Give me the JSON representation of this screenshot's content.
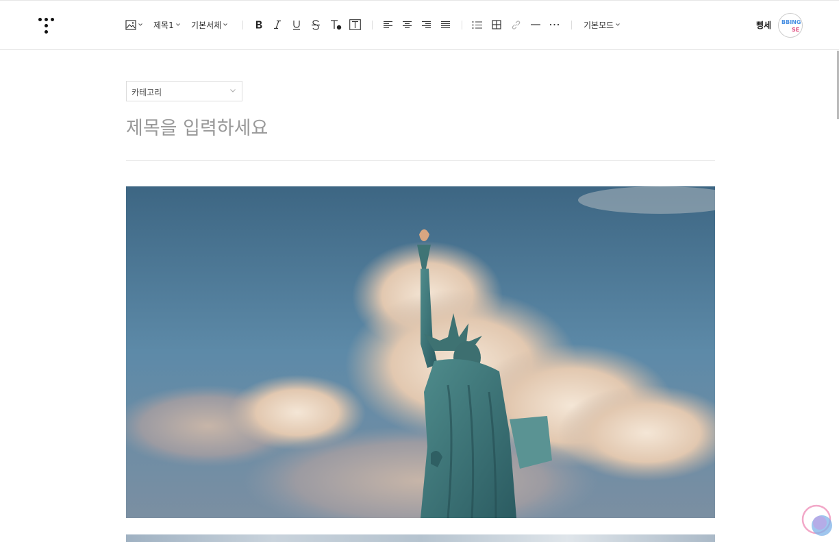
{
  "toolbar": {
    "heading_label": "제목1",
    "font_label": "기본서체",
    "mode_label": "기본모드"
  },
  "user": {
    "name": "삥세",
    "avatar_line1": "BBING",
    "avatar_line2": "SE"
  },
  "editor": {
    "category_placeholder": "카테고리",
    "title_placeholder": "제목을 입력하세요"
  },
  "icons": [
    "logo-icon",
    "image-icon",
    "bold-icon",
    "italic-icon",
    "underline-icon",
    "strikethrough-icon",
    "text-color-icon",
    "text-background-icon",
    "align-left-icon",
    "align-center-icon",
    "align-right-icon",
    "align-justify-icon",
    "bulleted-list-icon",
    "table-icon",
    "link-icon",
    "horizontal-rule-icon",
    "more-icon",
    "chevron-down-icon",
    "assistant-icon"
  ],
  "colors": {
    "text": "#333333",
    "placeholder": "#999999",
    "border": "#dcdcdc"
  }
}
